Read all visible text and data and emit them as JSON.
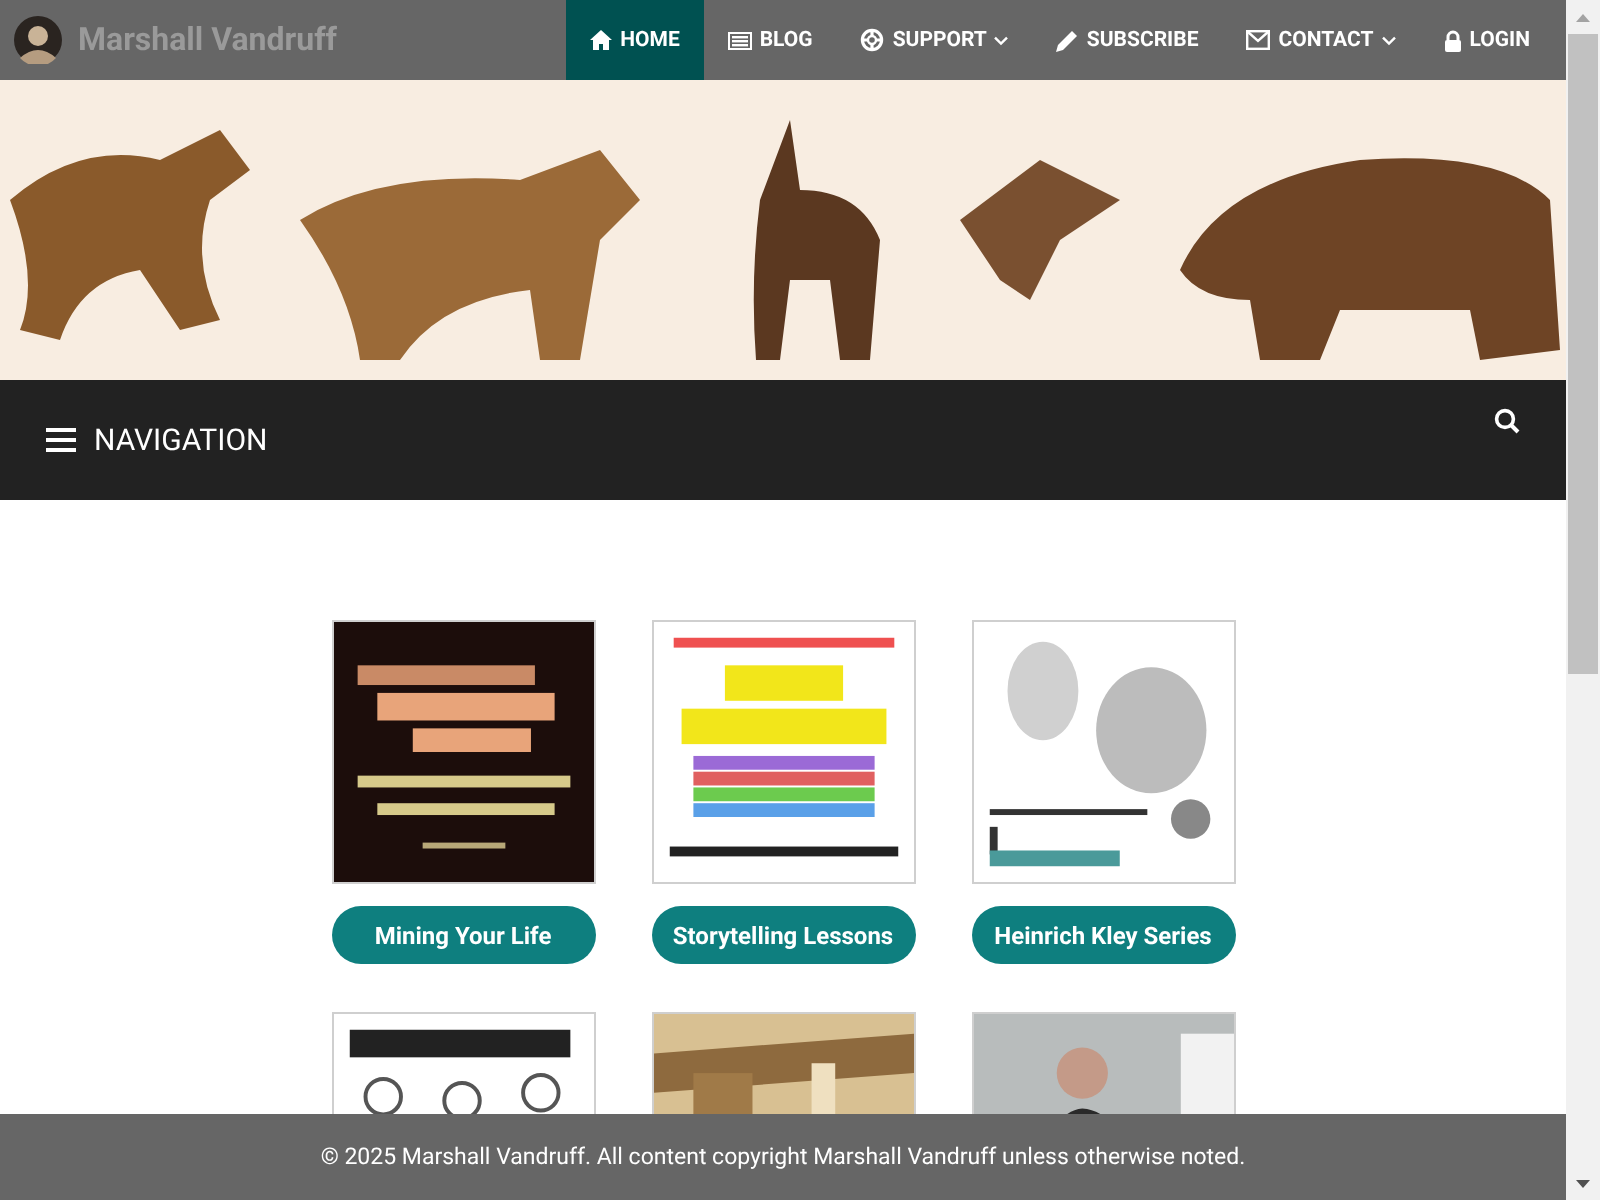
{
  "brand": {
    "name": "Marshall Vandruff"
  },
  "menu": [
    {
      "label": "HOME",
      "selected": true,
      "dropdown": false
    },
    {
      "label": "BLOG",
      "selected": false,
      "dropdown": false
    },
    {
      "label": "SUPPORT",
      "selected": false,
      "dropdown": true
    },
    {
      "label": "SUBSCRIBE",
      "selected": false,
      "dropdown": false
    },
    {
      "label": "CONTACT",
      "selected": false,
      "dropdown": true
    },
    {
      "label": "LOGIN",
      "selected": false,
      "dropdown": false
    }
  ],
  "banner": {
    "kind": "picture"
  },
  "navigation_bar": {
    "label": "NAVIGATION"
  },
  "tiles": [
    {
      "kind": "picture",
      "button": "Mining Your Life"
    },
    {
      "kind": "picture",
      "button": "Storytelling Lessons"
    },
    {
      "kind": "picture",
      "button": "Heinrich Kley Series"
    },
    {
      "kind": "picture"
    },
    {
      "kind": "picture"
    },
    {
      "kind": "picture"
    }
  ],
  "footer": {
    "text": "© 2025 Marshall Vandruff. All content copyright Marshall Vandruff unless otherwise noted."
  }
}
